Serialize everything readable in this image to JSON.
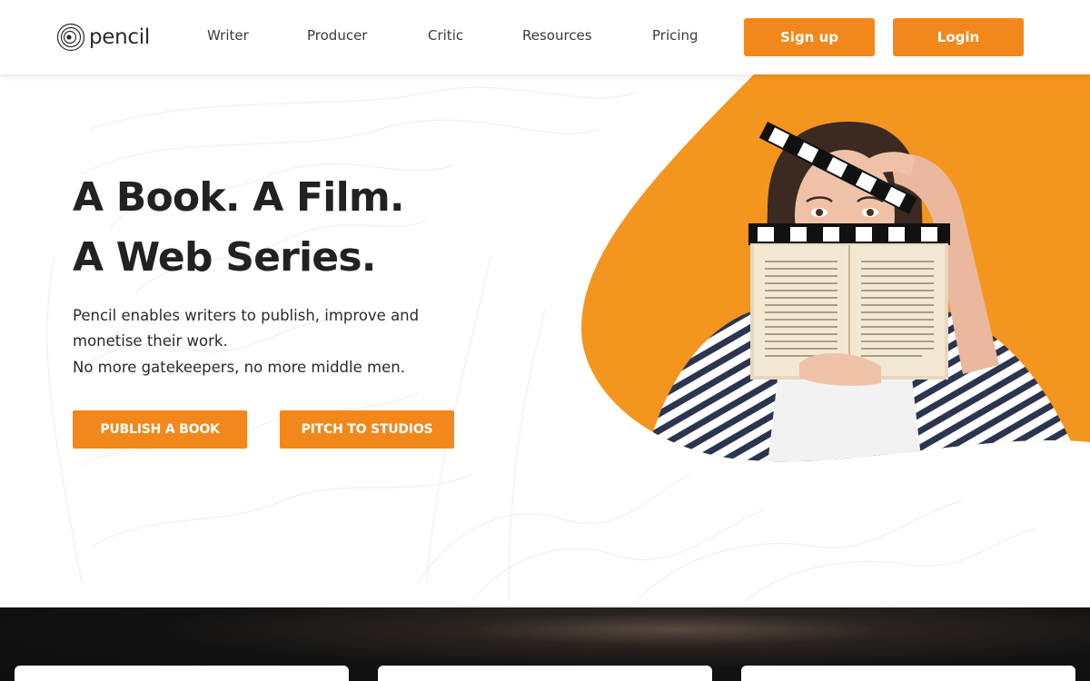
{
  "brand": {
    "name": "pencil",
    "accent": "#f2881c"
  },
  "nav": {
    "items": [
      {
        "label": "Writer"
      },
      {
        "label": "Producer"
      },
      {
        "label": "Critic"
      },
      {
        "label": "Resources"
      },
      {
        "label": "Pricing"
      }
    ],
    "signup_label": "Sign up",
    "login_label": "Login"
  },
  "hero": {
    "title_line1": "A Book. A Film.",
    "title_line2": "A Web Series.",
    "desc_line1": "Pencil enables writers to publish, improve and",
    "desc_line2": "monetise their work.",
    "desc_line3": "No more gatekeepers, no more middle men.",
    "publish_label": "PUBLISH A BOOK",
    "pitch_label": "PITCH TO STUDIOS"
  }
}
